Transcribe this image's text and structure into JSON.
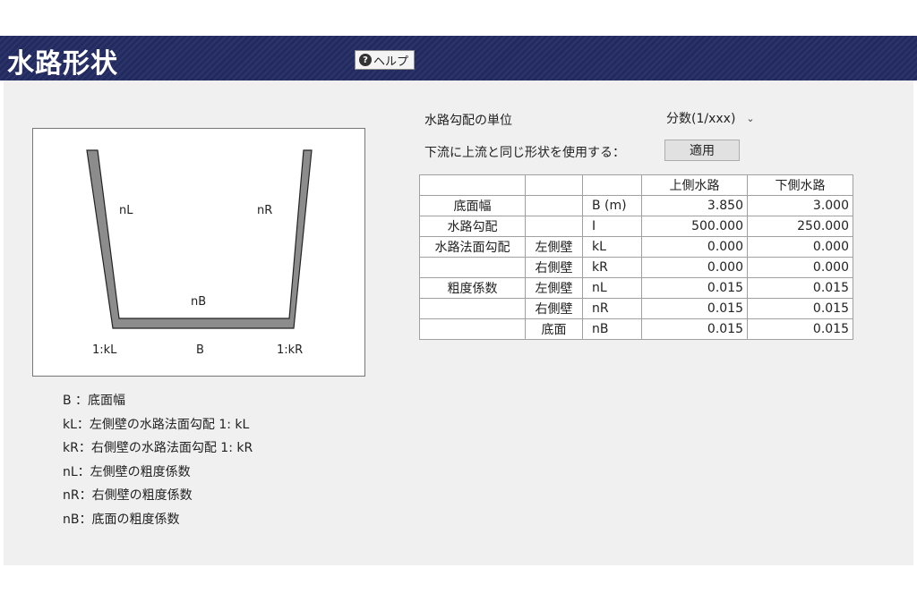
{
  "header": {
    "title": "水路形状",
    "help_label": "ヘルプ",
    "help_icon": "question-circle-icon"
  },
  "diagram": {
    "labels": {
      "nL": "nL",
      "nR": "nR",
      "nB": "nB",
      "kL": "1:kL",
      "B": "B",
      "kR": "1:kR"
    }
  },
  "legend": [
    "B ：底面幅",
    "kL：左側壁の水路法面勾配  1: kL",
    "kR：右側壁の水路法面勾配  1: kR",
    "nL：左側壁の粗度係数",
    "nR：右側壁の粗度係数",
    "nB：底面の粗度係数"
  ],
  "options": {
    "slope_unit_label": "水路勾配の単位",
    "slope_unit_value": "分数(1/xxx)",
    "same_shape_label": "下流に上流と同じ形状を使用する：",
    "apply_label": "適用"
  },
  "table": {
    "headers": [
      "",
      "",
      "",
      "上側水路",
      "下側水路"
    ],
    "rows": [
      [
        "底面幅",
        "",
        "B (m)",
        "3.850",
        "3.000"
      ],
      [
        "水路勾配",
        "",
        "I",
        "500.000",
        "250.000"
      ],
      [
        "水路法面勾配",
        "左側壁",
        "kL",
        "0.000",
        "0.000"
      ],
      [
        "",
        "右側壁",
        "kR",
        "0.000",
        "0.000"
      ],
      [
        "粗度係数",
        "左側壁",
        "nL",
        "0.015",
        "0.015"
      ],
      [
        "",
        "右側壁",
        "nR",
        "0.015",
        "0.015"
      ],
      [
        "",
        "底面",
        "nB",
        "0.015",
        "0.015"
      ]
    ]
  }
}
